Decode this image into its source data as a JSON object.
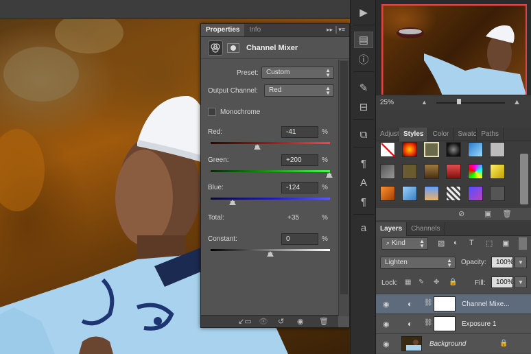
{
  "properties": {
    "tabs": [
      "Properties",
      "Info"
    ],
    "title": "Channel Mixer",
    "preset_label": "Preset:",
    "preset_value": "Custom",
    "output_label": "Output Channel:",
    "output_value": "Red",
    "monochrome_label": "Monochrome",
    "monochrome_checked": false,
    "red_label": "Red:",
    "red_value": "-41",
    "green_label": "Green:",
    "green_value": "+200",
    "blue_label": "Blue:",
    "blue_value": "-124",
    "total_label": "Total:",
    "total_value": "+35",
    "constant_label": "Constant:",
    "constant_value": "0",
    "pct": "%"
  },
  "navigator": {
    "zoom": "25%"
  },
  "style_tabs": [
    "Adjust",
    "Styles",
    "Color",
    "Swatc",
    "Paths"
  ],
  "layers_panel": {
    "tabs": [
      "Layers",
      "Channels"
    ],
    "filter_kind": "Kind",
    "blend_mode": "Lighten",
    "opacity_label": "Opacity:",
    "opacity_value": "100%",
    "lock_label": "Lock:",
    "fill_label": "Fill:",
    "fill_value": "100%",
    "layers": [
      {
        "name": "Channel Mixe..."
      },
      {
        "name": "Exposure 1"
      },
      {
        "name": "Background"
      }
    ]
  },
  "colors": {
    "panel_bg": "#535353",
    "dark_bg": "#3c3c3c",
    "selected_layer": "#5d6b7c",
    "nav_frame": "#dd4444"
  }
}
